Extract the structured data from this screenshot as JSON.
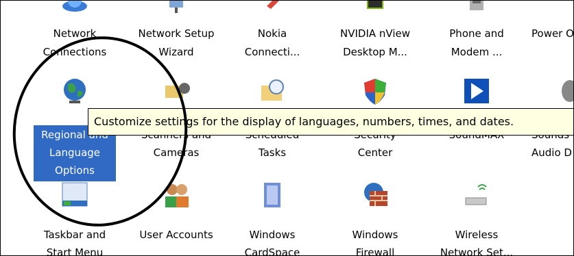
{
  "tooltip": "Customize settings for the display of languages, numbers, times, and dates.",
  "row1": [
    {
      "line1": "Network",
      "line2": "Connections"
    },
    {
      "line1": "Network Setup",
      "line2": "Wizard"
    },
    {
      "line1": "Nokia",
      "line2": "Connecti..."
    },
    {
      "line1": "NVIDIA nView",
      "line2": "Desktop M..."
    },
    {
      "line1": "Phone and",
      "line2": "Modem ..."
    },
    {
      "line1": "Power O",
      "line2": ""
    }
  ],
  "row2": [
    {
      "line1": "Regional and",
      "line2": "Language",
      "line3": "Options"
    },
    {
      "line1": "Scanners and",
      "line2": "Cameras"
    },
    {
      "line1": "Scheduled",
      "line2": "Tasks"
    },
    {
      "line1": "Security",
      "line2": "Center"
    },
    {
      "line1": "SoundMAX",
      "line2": ""
    },
    {
      "line1": "Sounds",
      "line2": "Audio D"
    }
  ],
  "row3": [
    {
      "line1": "Taskbar and",
      "line2": "Start Menu"
    },
    {
      "line1": "User Accounts",
      "line2": ""
    },
    {
      "line1": "Windows",
      "line2": "CardSpace"
    },
    {
      "line1": "Windows",
      "line2": "Firewall"
    },
    {
      "line1": "Wireless",
      "line2": "Network Set..."
    }
  ],
  "colors": {
    "selection": "#316ac5",
    "tooltip_bg": "#ffffe1"
  }
}
